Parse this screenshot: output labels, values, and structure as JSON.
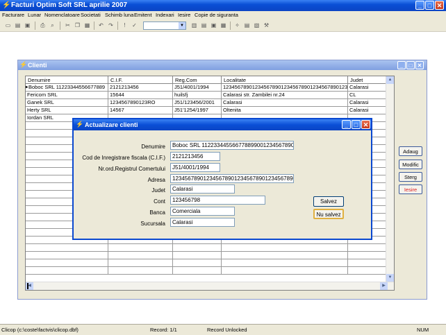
{
  "app": {
    "title": "Facturi Optim Soft SRL aprilie 2007"
  },
  "menu": [
    "Facturare",
    "Lunar",
    "Nomenclatoare",
    "Societati",
    "Schimb luna",
    "Emitent",
    "Indexari",
    "Iesire",
    "Copie de siguranta"
  ],
  "clienti_window": {
    "title": "Clienti",
    "columns": [
      "Denumire",
      "C.I.F.",
      "Reg.Com",
      "Localitate",
      "Judet"
    ],
    "rows": [
      [
        "Boboc SRL 11223344556677889",
        "2121213456",
        "J51/4001/1994",
        "1234567890123456789012345678901234567890123456789",
        "Calarasi"
      ],
      [
        "Fericom SRL",
        "15644",
        "huilsfj",
        "Calarasi str. Zambilei nr.24",
        "CL"
      ],
      [
        "Ganek SRL",
        "1234567890123RO",
        "J51/123456/2001",
        "Calarasi",
        "Calarasi"
      ],
      [
        "Herty SRL",
        "14567",
        "J51'1254/1997",
        "Oltenita",
        "Calarasi"
      ],
      [
        "Iordan SRL",
        "",
        "",
        "",
        ""
      ]
    ],
    "buttons": {
      "adaug": "Adaug",
      "modific": "Modific",
      "sterg": "Sterg",
      "iesire": "Iesire"
    }
  },
  "dialog": {
    "title": "Actualizare clienti",
    "fields": {
      "denumire": {
        "label": "Denumire",
        "value": "Boboc SRL 112233445566778899001234567890"
      },
      "cif": {
        "label": "Cod de Inregistrare fiscala (C.I.F.)",
        "value": "2121213456"
      },
      "regcom": {
        "label": "Nr.ord.Registrul Comertului",
        "value": "J51/4001/1994"
      },
      "adresa": {
        "label": "Adresa",
        "value": "1234567890123456789012345678901234567890"
      },
      "judet": {
        "label": "Judet",
        "value": "Calarasi"
      },
      "cont": {
        "label": "Cont",
        "value": "123456798"
      },
      "banca": {
        "label": "Banca",
        "value": "Comerciala"
      },
      "sucursala": {
        "label": "Sucursala",
        "value": "Calarasi"
      }
    },
    "buttons": {
      "salvez": "Salvez",
      "nu_salvez": "Nu salvez"
    }
  },
  "status": {
    "file": "Clicop (c:\\coste\\factvis\\clicop.dbf)",
    "record": "Record: 1/1",
    "lock": "Record Unlocked",
    "num": "NUM"
  },
  "colors": {
    "title_blue": "#0a4fd6",
    "face": "#ece9d8",
    "iesire_red": "#e02020"
  }
}
